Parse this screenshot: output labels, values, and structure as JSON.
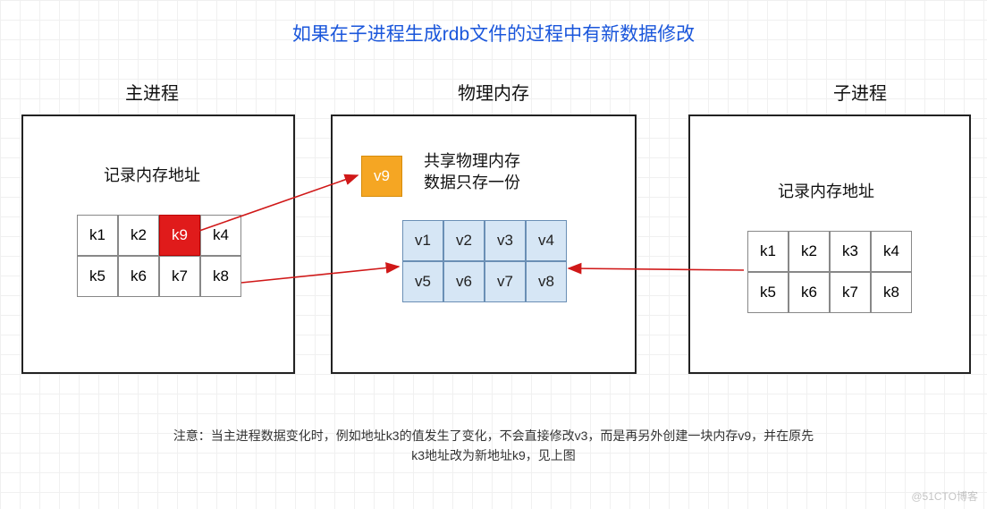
{
  "title": "如果在子进程生成rdb文件的过程中有新数据修改",
  "sections": {
    "main": {
      "label": "主进程",
      "sub": "记录内存地址"
    },
    "mem": {
      "label": "物理内存",
      "sub": "共享物理内存\n数据只存一份"
    },
    "child": {
      "label": "子进程",
      "sub": "记录内存地址"
    }
  },
  "main_cells": [
    "k1",
    "k2",
    "k9",
    "k4",
    "k5",
    "k6",
    "k7",
    "k8"
  ],
  "main_hot_index": 2,
  "mem_cells": [
    "v1",
    "v2",
    "v3",
    "v4",
    "v5",
    "v6",
    "v7",
    "v8"
  ],
  "v9_label": "v9",
  "child_cells": [
    "k1",
    "k2",
    "k3",
    "k4",
    "k5",
    "k6",
    "k7",
    "k8"
  ],
  "footnote_l1": "注意：当主进程数据变化时，例如地址k3的值发生了变化，不会直接修改v3，而是再另外创建一块内存v9，并在原先",
  "footnote_l2": "k3地址改为新地址k9，见上图",
  "watermark": "@51CTO博客",
  "chart_data": {
    "type": "table",
    "description": "Copy-on-write diagram: main & child processes hold address tables k1..k8 pointing to shared physical memory v1..v8. On write, main's k3 becomes k9 pointing to newly allocated v9.",
    "main_process_addresses": [
      "k1",
      "k2",
      "k9",
      "k4",
      "k5",
      "k6",
      "k7",
      "k8"
    ],
    "child_process_addresses": [
      "k1",
      "k2",
      "k3",
      "k4",
      "k5",
      "k6",
      "k7",
      "k8"
    ],
    "shared_physical_memory": [
      "v1",
      "v2",
      "v3",
      "v4",
      "v5",
      "v6",
      "v7",
      "v8"
    ],
    "new_block": "v9",
    "changed_slot": {
      "original": "k3",
      "now": "k9",
      "points_to": "v9"
    }
  }
}
